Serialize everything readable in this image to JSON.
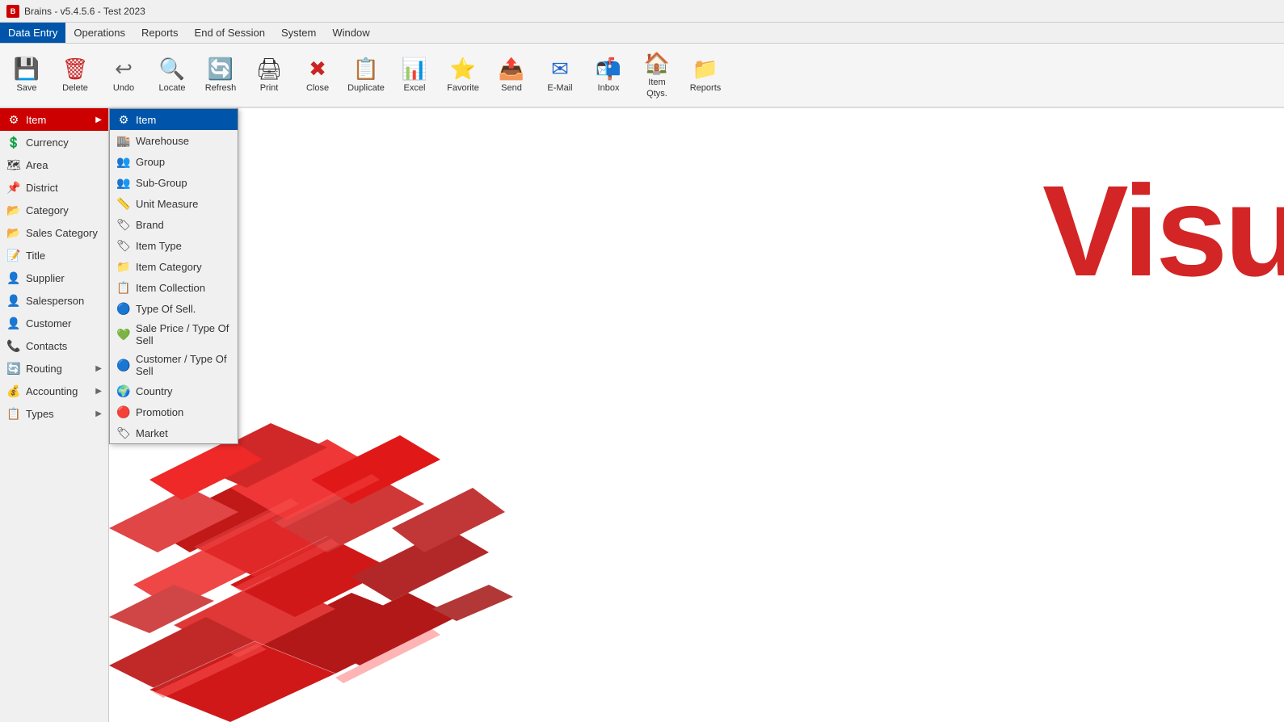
{
  "app": {
    "title": "Brains - v5.4.5.6 - Test 2023",
    "icon": "B"
  },
  "menubar": {
    "items": [
      {
        "id": "data-entry",
        "label": "Data Entry",
        "active": true
      },
      {
        "id": "operations",
        "label": "Operations"
      },
      {
        "id": "reports",
        "label": "Reports"
      },
      {
        "id": "end-of-session",
        "label": "End of Session"
      },
      {
        "id": "system",
        "label": "System"
      },
      {
        "id": "window",
        "label": "Window"
      }
    ]
  },
  "toolbar": {
    "buttons": [
      {
        "id": "save",
        "label": "Save",
        "icon": "💾",
        "class": "tb-save"
      },
      {
        "id": "delete",
        "label": "Delete",
        "icon": "🗑",
        "class": "tb-delete"
      },
      {
        "id": "undo",
        "label": "Undo",
        "icon": "↩",
        "class": "tb-undo"
      },
      {
        "id": "locate",
        "label": "Locate",
        "icon": "🔍",
        "class": "tb-locate"
      },
      {
        "id": "refresh",
        "label": "Refresh",
        "icon": "🔄",
        "class": "tb-refresh"
      },
      {
        "id": "print",
        "label": "Print",
        "icon": "🖨",
        "class": "tb-print"
      },
      {
        "id": "close",
        "label": "Close",
        "icon": "✖",
        "class": "tb-close"
      },
      {
        "id": "duplicate",
        "label": "Duplicate",
        "icon": "📋",
        "class": "tb-duplicate"
      },
      {
        "id": "excel",
        "label": "Excel",
        "icon": "📊",
        "class": "tb-excel"
      },
      {
        "id": "favorite",
        "label": "Favorite",
        "icon": "⭐",
        "class": "tb-favorite"
      },
      {
        "id": "send",
        "label": "Send",
        "icon": "📤",
        "class": "tb-send"
      },
      {
        "id": "email",
        "label": "E-Mail",
        "icon": "✉",
        "class": "tb-email"
      },
      {
        "id": "inbox",
        "label": "Inbox",
        "icon": "📬",
        "class": "tb-inbox"
      },
      {
        "id": "item-qtys",
        "label": "Item Qtys.",
        "icon": "🏠",
        "class": "tb-itemqtys"
      },
      {
        "id": "reports-btn",
        "label": "Reports",
        "icon": "📁",
        "class": "tb-reports"
      }
    ]
  },
  "sidebar": {
    "items": [
      {
        "id": "item",
        "label": "Item",
        "icon": "⚙",
        "hasSubmenu": true,
        "active": true
      },
      {
        "id": "currency",
        "label": "Currency",
        "icon": "💲"
      },
      {
        "id": "area",
        "label": "Area",
        "icon": "🗺"
      },
      {
        "id": "district",
        "label": "District",
        "icon": "📌"
      },
      {
        "id": "category",
        "label": "Category",
        "icon": "📂"
      },
      {
        "id": "sales-category",
        "label": "Sales Category",
        "icon": "📂"
      },
      {
        "id": "title",
        "label": "Title",
        "icon": "📝"
      },
      {
        "id": "supplier",
        "label": "Supplier",
        "icon": "👤"
      },
      {
        "id": "salesperson",
        "label": "Salesperson",
        "icon": "👤"
      },
      {
        "id": "customer",
        "label": "Customer",
        "icon": "👤"
      },
      {
        "id": "contacts",
        "label": "Contacts",
        "icon": "📞"
      },
      {
        "id": "routing",
        "label": "Routing",
        "icon": "🔄",
        "hasSubmenu": true
      },
      {
        "id": "accounting",
        "label": "Accounting",
        "icon": "💰",
        "hasSubmenu": true
      },
      {
        "id": "types",
        "label": "Types",
        "icon": "📋",
        "hasSubmenu": true
      }
    ]
  },
  "item_submenu": {
    "items": [
      {
        "id": "item",
        "label": "Item",
        "icon": "⚙",
        "highlighted": true
      },
      {
        "id": "warehouse",
        "label": "Warehouse",
        "icon": "🏬"
      },
      {
        "id": "group",
        "label": "Group",
        "icon": "👥"
      },
      {
        "id": "sub-group",
        "label": "Sub-Group",
        "icon": "👥"
      },
      {
        "id": "unit-measure",
        "label": "Unit Measure",
        "icon": "📏"
      },
      {
        "id": "brand",
        "label": "Brand",
        "icon": "🏷"
      },
      {
        "id": "item-type",
        "label": "Item Type",
        "icon": "🏷"
      },
      {
        "id": "item-category",
        "label": "Item Category",
        "icon": "📁"
      },
      {
        "id": "item-collection",
        "label": "Item Collection",
        "icon": "📋"
      },
      {
        "id": "type-of-sell",
        "label": "Type Of Sell.",
        "icon": "🔵"
      },
      {
        "id": "sale-price-type",
        "label": "Sale Price / Type Of Sell",
        "icon": "💚"
      },
      {
        "id": "customer-type",
        "label": "Customer / Type Of Sell",
        "icon": "🔵"
      },
      {
        "id": "country",
        "label": "Country",
        "icon": "🌍"
      },
      {
        "id": "promotion",
        "label": "Promotion",
        "icon": "🔴"
      },
      {
        "id": "market",
        "label": "Market",
        "icon": "🏷"
      }
    ]
  },
  "main": {
    "bg_text": "Visu"
  }
}
